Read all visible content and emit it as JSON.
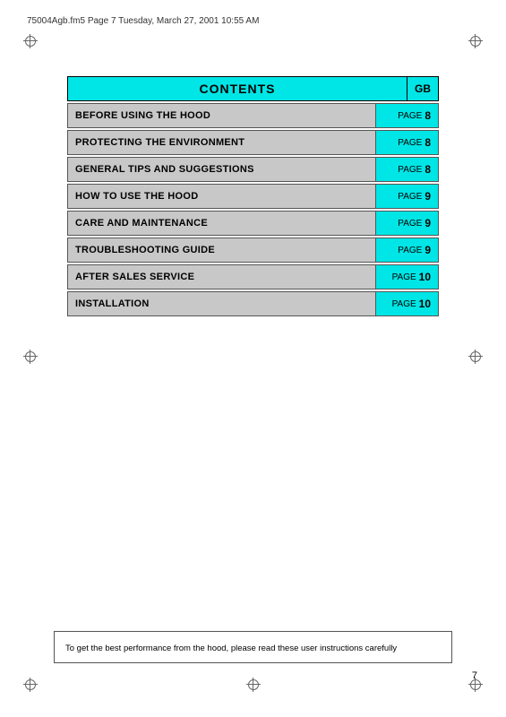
{
  "header": {
    "filename": "75004Agb.fm5  Page 7  Tuesday, March 27, 2001  10:55 AM"
  },
  "contents": {
    "title": "CONTENTS",
    "gb_label": "GB"
  },
  "toc": {
    "rows": [
      {
        "label": "BEFORE USING THE HOOD",
        "page_prefix": "PAGE",
        "page_num": "8"
      },
      {
        "label": "PROTECTING THE ENVIRONMENT",
        "page_prefix": "PAGE",
        "page_num": "8"
      },
      {
        "label": "GENERAL TIPS AND SUGGESTIONS",
        "page_prefix": "PAGE",
        "page_num": "8"
      },
      {
        "label": "HOW TO USE THE HOOD",
        "page_prefix": "PAGE",
        "page_num": "9"
      },
      {
        "label": "CARE AND MAINTENANCE",
        "page_prefix": "PAGE",
        "page_num": "9"
      },
      {
        "label": "TROUBLESHOOTING GUIDE",
        "page_prefix": "PAGE",
        "page_num": "9"
      },
      {
        "label": "AFTER SALES SERVICE",
        "page_prefix": "PAGE",
        "page_num": "10"
      },
      {
        "label": "INSTALLATION",
        "page_prefix": "PAGE",
        "page_num": "10"
      }
    ]
  },
  "bottom_note": {
    "text": "To get the best performance from the hood, please read these user instructions carefully"
  },
  "page_number": "7"
}
